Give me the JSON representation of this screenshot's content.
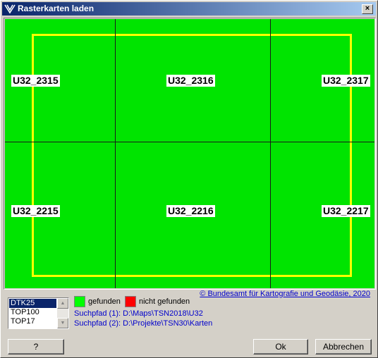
{
  "window": {
    "title": "Rasterkarten laden",
    "close_label": "×"
  },
  "tiles": [
    {
      "label": "U32_2315"
    },
    {
      "label": "U32_2316"
    },
    {
      "label": "U32_2317"
    },
    {
      "label": "U32_2215"
    },
    {
      "label": "U32_2216"
    },
    {
      "label": "U32_2217"
    }
  ],
  "map_list": {
    "items": [
      "DTK25",
      "TOP100",
      "TOP17"
    ],
    "selected": "DTK25"
  },
  "legend": {
    "found_label": "gefunden",
    "found_color": "#00ff00",
    "missing_label": "nicht gefunden",
    "missing_color": "#ff0000"
  },
  "copyright": "© Bundesamt für Kartografie und Geodäsie, 2020",
  "paths": [
    "Suchpfad (1): D:\\Maps\\TSN2018\\U32",
    "Suchpfad (2): D:\\Projekte\\TSN30\\Karten"
  ],
  "buttons": {
    "help": "?",
    "ok": "Ok",
    "cancel": "Abbrechen"
  },
  "colors": {
    "map_fill": "#00e400",
    "area_outline": "#ffff00"
  }
}
